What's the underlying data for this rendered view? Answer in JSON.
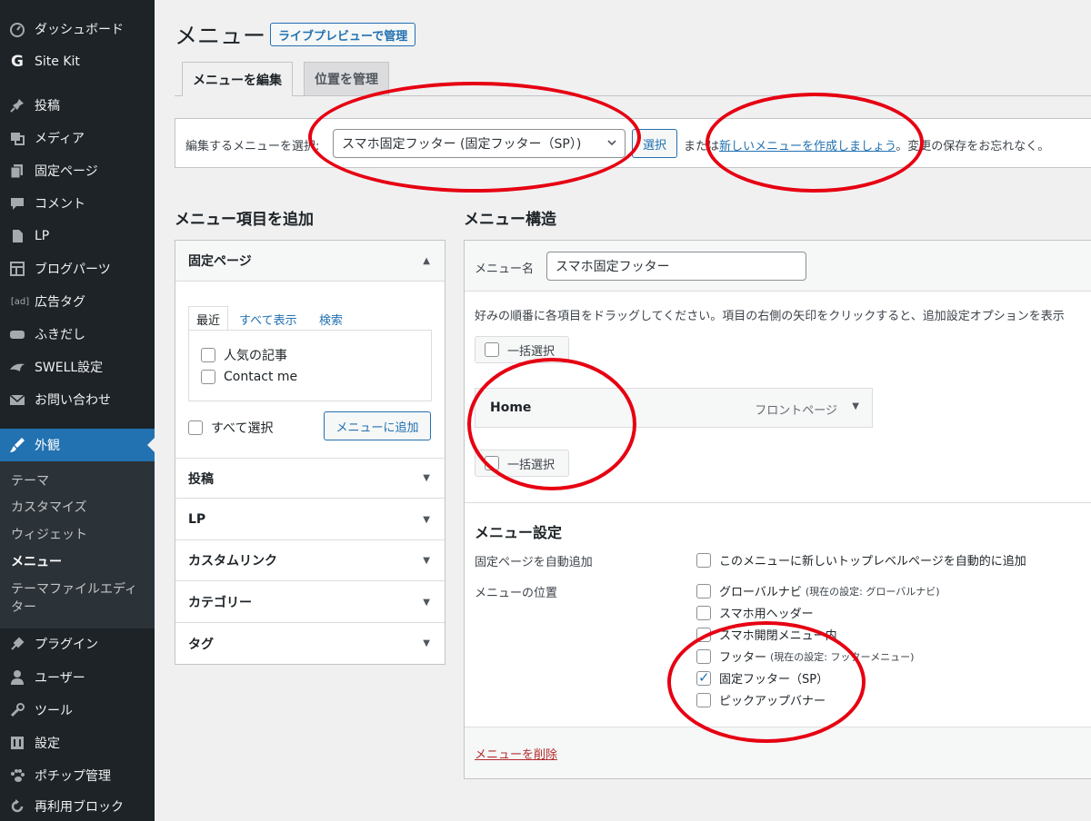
{
  "sidebar": {
    "items": [
      {
        "label": "ダッシュボード",
        "icon": "dashboard-icon"
      },
      {
        "label": "Site Kit",
        "icon": "site-kit-icon"
      },
      {
        "label": "投稿",
        "icon": "pin-icon"
      },
      {
        "label": "メディア",
        "icon": "media-icon"
      },
      {
        "label": "固定ページ",
        "icon": "page-icon"
      },
      {
        "label": "コメント",
        "icon": "comment-icon"
      },
      {
        "label": "LP",
        "icon": "document-icon"
      },
      {
        "label": "ブログパーツ",
        "icon": "layout-icon"
      },
      {
        "label": "広告タグ",
        "icon": "ad-icon"
      },
      {
        "label": "ふきだし",
        "icon": "speech-bubble-icon"
      },
      {
        "label": "SWELL設定",
        "icon": "swell-icon"
      },
      {
        "label": "お問い合わせ",
        "icon": "mail-icon"
      },
      {
        "label": "外観",
        "icon": "appearance-icon"
      },
      {
        "label": "プラグイン",
        "icon": "plugin-icon"
      },
      {
        "label": "ユーザー",
        "icon": "user-icon"
      },
      {
        "label": "ツール",
        "icon": "wrench-icon"
      },
      {
        "label": "設定",
        "icon": "settings-icon"
      },
      {
        "label": "ポチップ管理",
        "icon": "paw-icon"
      },
      {
        "label": "再利用ブロック",
        "icon": "refresh-icon"
      }
    ],
    "submenu": [
      "テーマ",
      "カスタマイズ",
      "ウィジェット",
      "メニュー",
      "テーマファイルエディター"
    ]
  },
  "header": {
    "title": "メニュー",
    "live_preview": "ライブプレビューで管理",
    "tabs": [
      "メニューを編集",
      "位置を管理"
    ]
  },
  "manage": {
    "label": "編集するメニューを選択:",
    "selected_menu": "スマホ固定フッター (固定フッター（SP）)",
    "select_button": "選択",
    "or_text": "または",
    "create_link": "新しいメニューを作成しましょう",
    "save_reminder": "。変更の保存をお忘れなく。"
  },
  "add_items": {
    "title": "メニュー項目を追加",
    "open_section": "固定ページ",
    "page_tabs": [
      "最近",
      "すべて表示",
      "検索"
    ],
    "pages": [
      "人気の記事",
      "Contact me"
    ],
    "select_all": "すべて選択",
    "add_button": "メニューに追加",
    "sections": [
      "投稿",
      "LP",
      "カスタムリンク",
      "カテゴリー",
      "タグ"
    ]
  },
  "structure": {
    "title": "メニュー構造",
    "name_label": "メニュー名",
    "name_value": "スマホ固定フッター",
    "help": "好みの順番に各項目をドラッグしてください。項目の右側の矢印をクリックすると、追加設定オプションを表示",
    "bulk_select": "一括選択",
    "items": [
      {
        "title": "Home",
        "type": "フロントページ"
      }
    ]
  },
  "settings": {
    "title": "メニュー設定",
    "auto_add_label": "固定ページを自動追加",
    "auto_add_option": "このメニューに新しいトップレベルページを自動的に追加",
    "location_label": "メニューの位置",
    "locations": [
      {
        "label": "グローバルナビ",
        "note": "(現在の設定: グローバルナビ)",
        "checked": false
      },
      {
        "label": "スマホ用ヘッダー",
        "note": "",
        "checked": false
      },
      {
        "label": "スマホ開閉メニュー内",
        "note": "",
        "checked": false
      },
      {
        "label": "フッター",
        "note": "(現在の設定: フッターメニュー)",
        "checked": false
      },
      {
        "label": "固定フッター（SP）",
        "note": "",
        "checked": true
      },
      {
        "label": "ピックアップバナー",
        "note": "",
        "checked": false
      }
    ],
    "delete_link": "メニューを削除"
  },
  "colors": {
    "accent": "#2271b1",
    "sidebar": "#1d2327",
    "annotation": "#e60012",
    "danger": "#b32d2e"
  }
}
